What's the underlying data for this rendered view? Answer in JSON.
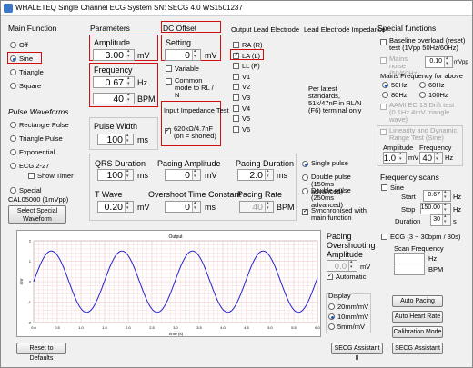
{
  "window": {
    "title": "WHALETEQ Single Channel ECG System",
    "serial": "SN: SECG 4.0 WS1501237"
  },
  "main_function": {
    "header": "Main Function",
    "items": [
      "Off",
      "Sine",
      "Triangle",
      "Square"
    ],
    "selected": "Sine"
  },
  "pulse": {
    "header": "Pulse Waveforms",
    "items": [
      "Rectangle Pulse",
      "Triangle Pulse",
      "Exponential",
      "ECG 2-27"
    ],
    "show_timer": "Show Timer",
    "special": "Special",
    "special_sub": "CAL05000 (1mVpp)",
    "select_btn": "Select Special Waveform"
  },
  "parameters": {
    "header": "Parameters",
    "amplitude_label": "Amplitude",
    "amplitude": "3.00",
    "amplitude_unit": "mV",
    "frequency_label": "Frequency",
    "frequency": "0.67",
    "frequency_unit": "Hz",
    "bpm": "40",
    "bpm_unit": "BPM",
    "pulse_width_label": "Pulse Width",
    "pulse_width": "100",
    "pulse_width_unit": "ms"
  },
  "dc_offset": {
    "header": "DC Offset",
    "setting_label": "Setting",
    "setting": "0",
    "setting_unit": "mV",
    "variable": "Variable",
    "common_mode": "Common mode to RL / N",
    "impedance_header": "Input Impedance Test",
    "impedance_item": "620kΩ/4.7nF (on = shorted)"
  },
  "output_lead": {
    "header": "Output Lead Electrode",
    "items": [
      "RA (R)",
      "LA (L)",
      "LL (F)",
      "V1",
      "V2",
      "V3",
      "V4",
      "V5",
      "V6"
    ],
    "selected": "LA (L)"
  },
  "lead_impedance": {
    "header": "Lead Electrode Impedance",
    "note": "Per latest standards, 51k/47nF in RL/N (F6) terminal only"
  },
  "special_functions": {
    "header": "Special functions",
    "baseline": "Baseline overload (reset) test (1Vpp 50Hz/60Hz)",
    "mains_noise": "Mains noise (50/60Hz)",
    "mains_value": "0.10",
    "mains_unit": "mVpp",
    "mains_freq_label": "Mains Frequency for above",
    "freq_options": [
      "50Hz",
      "60Hz",
      "80Hz",
      "100Hz"
    ],
    "aami_drift": "AAMI EC 13 Drift test (0.1Hz 4mV triangle wave)",
    "linearity": "Linearity and Dynamic Range Test (Sine)",
    "amp_label": "Amplitude",
    "freq_label": "Frequency",
    "lin_amp": "1.0",
    "lin_amp_unit": "mV",
    "lin_freq": "40",
    "lin_freq_unit": "Hz"
  },
  "freq_scans": {
    "header": "Frequency scans",
    "sine": "Sine",
    "start_label": "Start",
    "start": "0.67",
    "start_unit": "Hz",
    "stop_label": "Stop",
    "stop": "150.00",
    "stop_unit": "Hz",
    "duration_label": "Duration",
    "duration": "30",
    "duration_unit": "s",
    "ecg_scan": "ECG (3 ~ 30bpm / 30s)",
    "scan_freq_label": "Scan Frequency",
    "scan_hz": "Hz",
    "scan_bpm": "BPM"
  },
  "qrs": {
    "qrs_label": "QRS Duration",
    "qrs": "100",
    "qrs_unit": "ms",
    "pacing_amp_label": "Pacing Amplitude",
    "pacing_amp": "0",
    "pacing_amp_unit": "mV",
    "pacing_dur_label": "Pacing Duration",
    "pacing_dur": "2.0",
    "pacing_dur_unit": "ms",
    "t_wave_label": "T Wave",
    "t_wave": "0.20",
    "t_wave_unit": "mV",
    "overshoot_tc_label": "Overshoot Time Constant",
    "overshoot_tc": "0",
    "overshoot_tc_unit": "ms",
    "pacing_rate_label": "Pacing Rate",
    "pacing_rate": "40",
    "pacing_rate_unit": "BPM"
  },
  "pulse_mode": {
    "items": [
      "Single pulse",
      "Double pulse (150ms advanced)",
      "Double pulse (250ms advanced)"
    ],
    "selected": "Single pulse",
    "sync": "Synchronised with main function"
  },
  "pacing_overshoot": {
    "label": "Pacing Overshooting Amplitude",
    "value": "0.0",
    "unit": "mV",
    "automatic": "Automatic"
  },
  "display": {
    "header": "Display",
    "items": [
      "20mm/mV",
      "10mm/mV",
      "5mm/mV"
    ],
    "selected": "10mm/mV"
  },
  "buttons": {
    "auto_pacing": "Auto Pacing",
    "auto_heart_rate": "Auto Heart Rate",
    "calibration": "Calibration Mode",
    "assistant2": "SECG Assistant II",
    "assistant": "SECG Assistant",
    "reset": "Reset to Defaults"
  },
  "chart_data": {
    "type": "line",
    "title": "Output",
    "xlabel": "Time (s)",
    "ylabel": "mV",
    "xlim": [
      0,
      6
    ],
    "ylim": [
      -2,
      2
    ],
    "x_ticks": [
      "0.0",
      "0.5",
      "1.0",
      "1.5",
      "2.0",
      "2.5",
      "3.0",
      "3.5",
      "4.0",
      "4.5",
      "5.0",
      "5.5",
      "6.0"
    ],
    "y_ticks": [
      "2",
      "1",
      "0",
      "-1",
      "-2"
    ],
    "series": [
      {
        "frequency_hz": 0.67,
        "amplitude_mv": 1.5,
        "color": "#2222cc"
      }
    ],
    "grid": true
  }
}
